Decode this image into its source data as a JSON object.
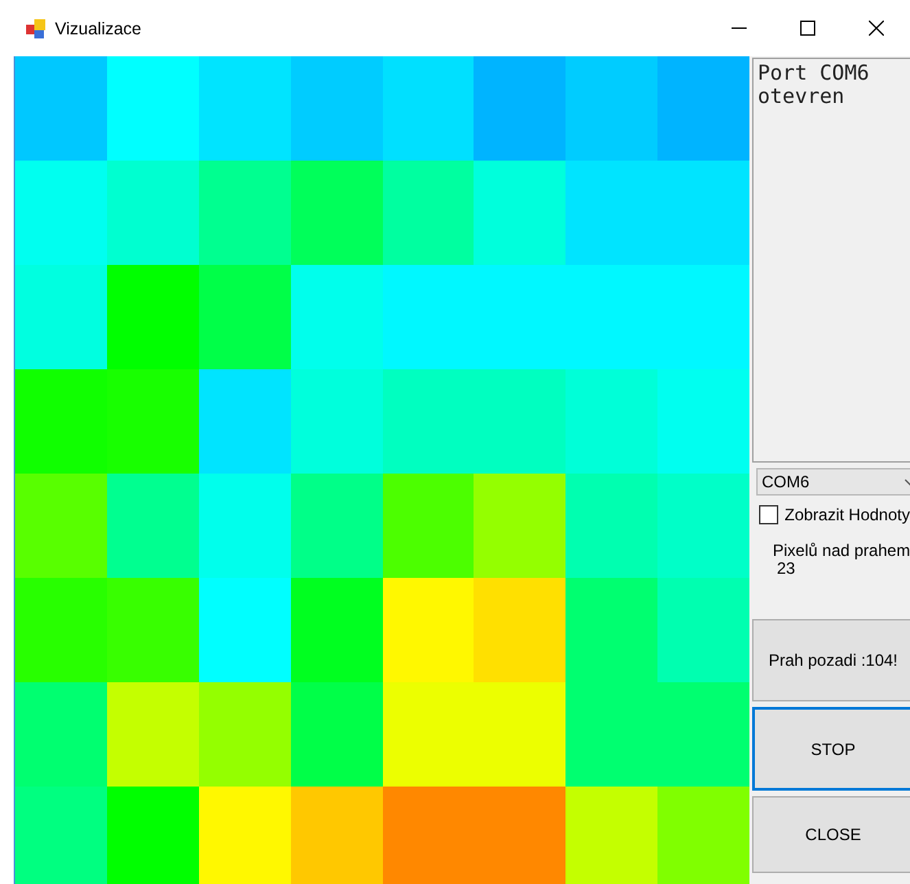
{
  "window": {
    "title": "Vizualizace",
    "controls": [
      {
        "kind": "minimize"
      },
      {
        "kind": "maximize"
      },
      {
        "kind": "close"
      }
    ]
  },
  "heatmap": {
    "rows": [
      {
        "cells": [
          {
            "color": "#00c8ff"
          },
          {
            "color": "#00ffff"
          },
          {
            "color": "#00e4ff"
          },
          {
            "color": "#00ccff"
          },
          {
            "color": "#00e0ff"
          },
          {
            "color": "#00b4ff"
          },
          {
            "color": "#00ccff"
          },
          {
            "color": "#00b4ff"
          }
        ]
      },
      {
        "cells": [
          {
            "color": "#00fff0"
          },
          {
            "color": "#00ffd0"
          },
          {
            "color": "#00ff90"
          },
          {
            "color": "#00ff5a"
          },
          {
            "color": "#00ffa0"
          },
          {
            "color": "#00ffdc"
          },
          {
            "color": "#00e4ff"
          },
          {
            "color": "#00e4ff"
          }
        ]
      },
      {
        "cells": [
          {
            "color": "#00ffe0"
          },
          {
            "color": "#00ff00"
          },
          {
            "color": "#00ff48"
          },
          {
            "color": "#00ffec"
          },
          {
            "color": "#00f8ff"
          },
          {
            "color": "#00f8ff"
          },
          {
            "color": "#00f8ff"
          },
          {
            "color": "#00f8ff"
          }
        ]
      },
      {
        "cells": [
          {
            "color": "#10ff00"
          },
          {
            "color": "#18ff00"
          },
          {
            "color": "#00e4ff"
          },
          {
            "color": "#00ffdc"
          },
          {
            "color": "#00ffc0"
          },
          {
            "color": "#00ffc0"
          },
          {
            "color": "#00ffd8"
          },
          {
            "color": "#00fff0"
          }
        ]
      },
      {
        "cells": [
          {
            "color": "#58ff00"
          },
          {
            "color": "#00ff90"
          },
          {
            "color": "#00ffec"
          },
          {
            "color": "#00ff88"
          },
          {
            "color": "#4cff00"
          },
          {
            "color": "#94ff00"
          },
          {
            "color": "#00ffb0"
          },
          {
            "color": "#00ffc8"
          }
        ]
      },
      {
        "cells": [
          {
            "color": "#28ff00"
          },
          {
            "color": "#38ff00"
          },
          {
            "color": "#00ffff"
          },
          {
            "color": "#00ff20"
          },
          {
            "color": "#fff800"
          },
          {
            "color": "#ffe000"
          },
          {
            "color": "#00ff70"
          },
          {
            "color": "#00ffb0"
          }
        ]
      },
      {
        "cells": [
          {
            "color": "#00ff70"
          },
          {
            "color": "#c4ff00"
          },
          {
            "color": "#94ff00"
          },
          {
            "color": "#00ff48"
          },
          {
            "color": "#ecff00"
          },
          {
            "color": "#ecff00"
          },
          {
            "color": "#00ff70"
          },
          {
            "color": "#00ff70"
          }
        ]
      },
      {
        "cells": [
          {
            "color": "#00ff80"
          },
          {
            "color": "#00ff00"
          },
          {
            "color": "#fff800"
          },
          {
            "color": "#ffc800"
          },
          {
            "color": "#ff8800"
          },
          {
            "color": "#ff8800"
          },
          {
            "color": "#c4ff00"
          },
          {
            "color": "#80ff00"
          }
        ]
      }
    ]
  },
  "log": {
    "lines": [
      "Port COM6",
      "otevren"
    ]
  },
  "port_select": {
    "value": "COM6"
  },
  "show_values": {
    "label": "Zobrazit Hodnoty",
    "checked": false
  },
  "pixel_count": {
    "label": "Pixelů nad prahem",
    "value": "23"
  },
  "buttons": [
    {
      "label": "Prah pozadi :104!",
      "focused": false
    },
    {
      "label": "STOP",
      "focused": true
    },
    {
      "label": "CLOSE",
      "focused": false
    }
  ]
}
